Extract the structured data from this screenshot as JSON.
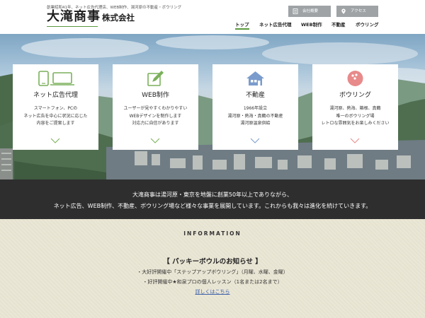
{
  "header": {
    "tagline": "創業昭和41年、ネット広告代理店、WEB制作、湯河原の不動産・ボウリング",
    "logo_main": "大滝商事",
    "logo_sub": "株式会社",
    "utility": {
      "company": "会社概要",
      "access": "アクセス"
    },
    "nav": [
      "トップ",
      "ネット広告代理",
      "WEB制作",
      "不動産",
      "ボウリング"
    ],
    "accent_color": "#5b9a3f"
  },
  "services": [
    {
      "title": "ネット広告代理",
      "icon": "smartphone-monitor-icon",
      "desc": [
        "スマートフォン、PCの",
        "ネット広告を中心に状況に応じた",
        "内容をご提案します"
      ]
    },
    {
      "title": "WEB制作",
      "icon": "pencil-edit-icon",
      "desc": [
        "ユーザーが見やすくわかりやすい",
        "WEBデザインを制作します",
        "対応力に自信があります"
      ]
    },
    {
      "title": "不動産",
      "icon": "house-icon",
      "desc": [
        "1966年設立",
        "湯河原・熱海・真鶴の不動産",
        "湯河原温泉供給"
      ]
    },
    {
      "title": "ボウリング",
      "icon": "bowling-ball-icon",
      "desc": [
        "湯河原、熱海、箱根、真鶴",
        "唯一のボウリング場",
        "レトロな雰囲気をお楽しみください"
      ]
    }
  ],
  "intro": {
    "line1": "大滝商事は湯河原・東京を地盤に創業50年以上でありながら、",
    "line2": "ネット広告、WEB制作、不動産、ボウリング場など様々な事業を展開しています。これからも我々は進化を続けていきます。"
  },
  "information": {
    "heading": "INFORMATION",
    "notice_title": "【 パッキーボウルのお知らせ 】",
    "lines": [
      "・大好評開催中「ステップアップボウリング」（月曜、水曜、金曜）",
      "・好評開催中★和泉プロの個人レッスン（1名または2名まで）"
    ],
    "more_link": "詳しくはこちら"
  }
}
